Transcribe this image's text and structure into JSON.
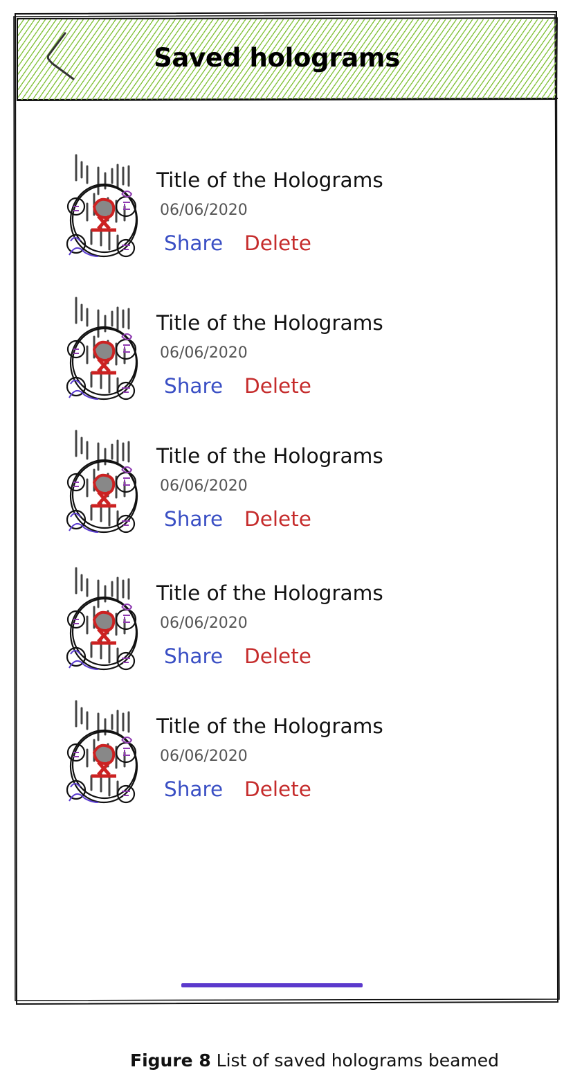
{
  "header": {
    "title": "Saved holograms",
    "back_icon": "chevron-left-icon",
    "accent_color": "#86c440"
  },
  "holograms": [
    {
      "title": "Title of the Holograms",
      "date": "06/06/2020",
      "share_label": "Share",
      "delete_label": "Delete",
      "thumbnail_icon": "hologram-sketch-icon"
    },
    {
      "title": "Title of the Holograms",
      "date": "06/06/2020",
      "share_label": "Share",
      "delete_label": "Delete",
      "thumbnail_icon": "hologram-sketch-icon"
    },
    {
      "title": "Title of the Holograms",
      "date": "06/06/2020",
      "share_label": "Share",
      "delete_label": "Delete",
      "thumbnail_icon": "hologram-sketch-icon"
    },
    {
      "title": "Title of the Holograms",
      "date": "06/06/2020",
      "share_label": "Share",
      "delete_label": "Delete",
      "thumbnail_icon": "hologram-sketch-icon"
    },
    {
      "title": "Title of the Holograms",
      "date": "06/06/2020",
      "share_label": "Share",
      "delete_label": "Delete",
      "thumbnail_icon": "hologram-sketch-icon"
    }
  ],
  "colors": {
    "share": "#3a4fc4",
    "delete": "#c52b2b",
    "home_indicator": "#5b39cc"
  },
  "caption": {
    "label": "Figure 8",
    "text": " List of saved holograms beamed"
  }
}
